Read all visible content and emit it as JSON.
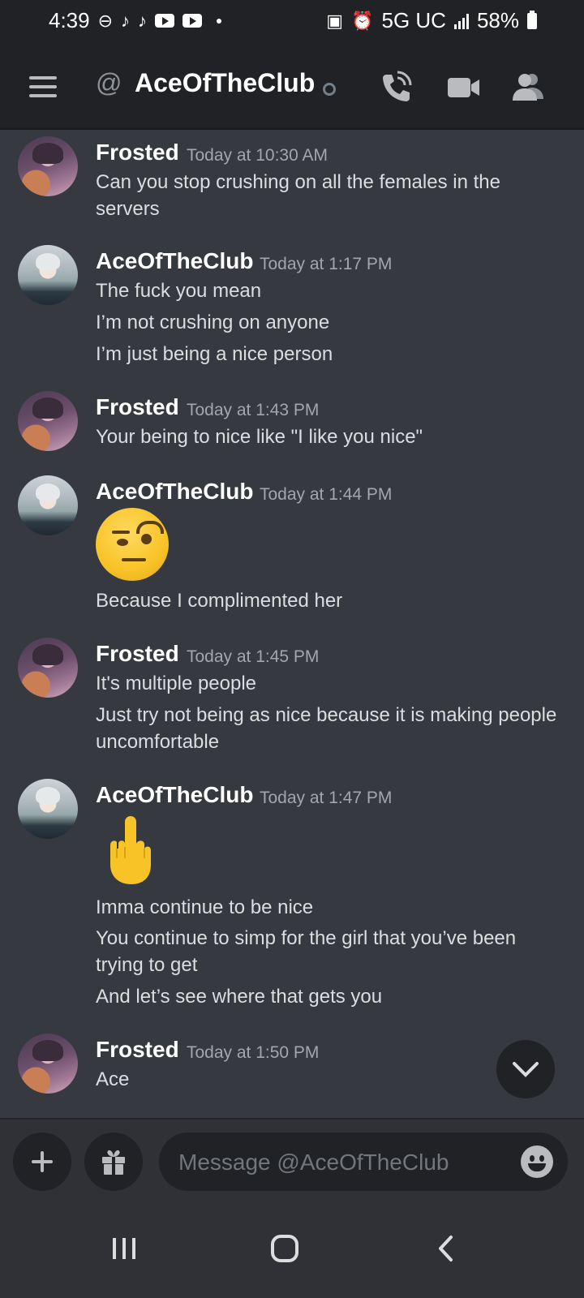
{
  "status_bar": {
    "time": "4:39",
    "network": "5G UC",
    "battery": "58%"
  },
  "header": {
    "at_symbol": "@",
    "title": "AceOfTheClub"
  },
  "messages": [
    {
      "author": "Frosted",
      "time": "Today at 10:30 AM",
      "lines": [
        "Can you stop crushing on all the females in the servers"
      ]
    },
    {
      "author": "AceOfTheClub",
      "time": "Today at 1:17 PM",
      "lines": [
        "The fuck you mean",
        "I’m not crushing on anyone",
        "I’m just being a nice person"
      ]
    },
    {
      "author": "Frosted",
      "time": "Today at 1:43 PM",
      "lines": [
        "Your being to nice like \"I like you nice\""
      ]
    },
    {
      "author": "AceOfTheClub",
      "time": "Today at 1:44 PM",
      "emoji": "face-with-raised-eyebrow",
      "lines": [
        "Because I complimented her"
      ]
    },
    {
      "author": "Frosted",
      "time": "Today at 1:45 PM",
      "lines": [
        "It's multiple people",
        "Just try not being as nice because it is making people uncomfortable"
      ]
    },
    {
      "author": "AceOfTheClub",
      "time": "Today at 1:47 PM",
      "emoji": "middle-finger",
      "lines": [
        "Imma continue to be nice",
        "You continue to simp for the girl that you’ve been trying to get",
        "And let’s see where that gets you"
      ]
    },
    {
      "author": "Frosted",
      "time": "Today at 1:50 PM",
      "lines": [
        "Ace"
      ]
    }
  ],
  "input": {
    "placeholder": "Message @AceOfTheClub"
  },
  "colors": {
    "background": "#36393f",
    "header": "#202225",
    "text": "#dcddde",
    "timestamp": "#a3a6aa"
  }
}
